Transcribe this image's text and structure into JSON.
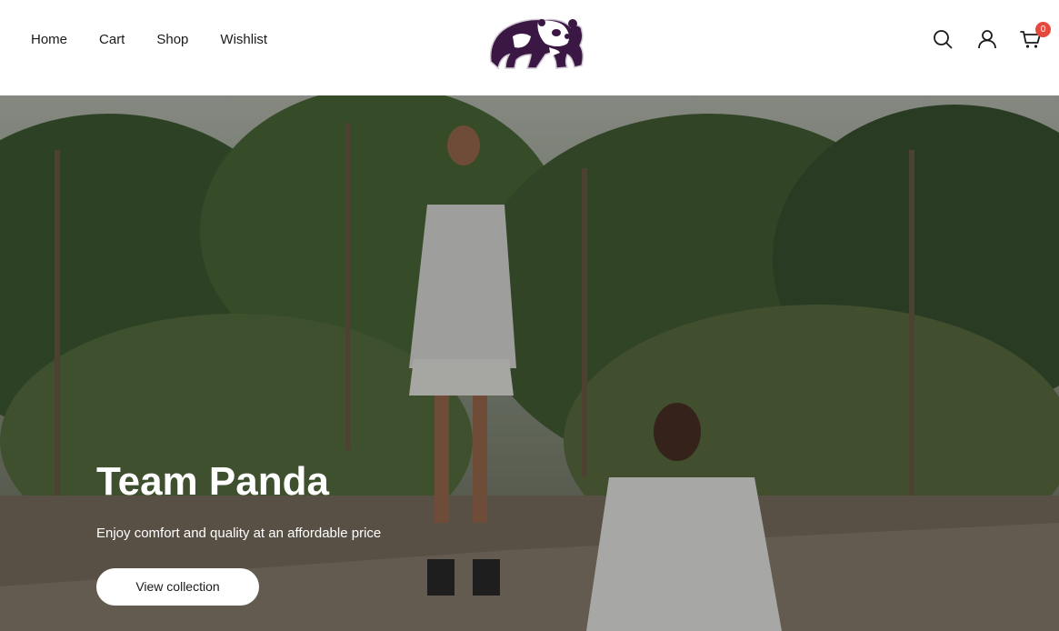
{
  "header": {
    "nav": [
      {
        "label": "Home"
      },
      {
        "label": "Cart"
      },
      {
        "label": "Shop"
      },
      {
        "label": "Wishlist"
      }
    ],
    "logo": {
      "icon": "panda-logo-icon",
      "color": "#3b1744"
    },
    "icons": {
      "search": "search-icon",
      "account": "user-icon",
      "cart": "cart-icon",
      "cart_count": "0"
    }
  },
  "hero": {
    "title": "Team Panda",
    "subtitle": "Enjoy comfort and quality at an affordable price",
    "cta_label": "View collection"
  },
  "colors": {
    "badge": "#e5483c",
    "logo": "#3b1744",
    "text": "#1a1a1a"
  }
}
